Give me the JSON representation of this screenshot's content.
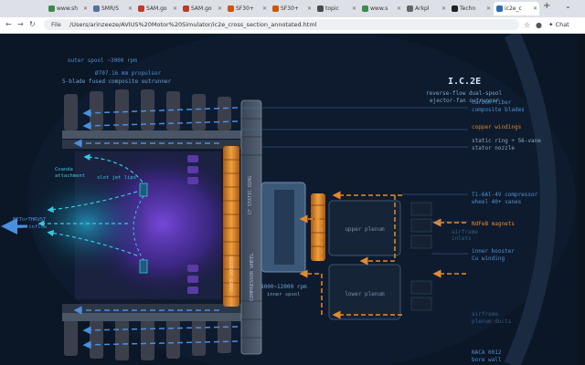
{
  "browser": {
    "tabs": [
      {
        "label": "www.sh",
        "color": "#3c8b4a"
      },
      {
        "label": "SMR/S",
        "color": "#5a6e9a"
      },
      {
        "label": "SAM.go",
        "color": "#c0392b"
      },
      {
        "label": "SAM.go",
        "color": "#c0392b"
      },
      {
        "label": "SF30+",
        "color": "#d35400"
      },
      {
        "label": "SF30+",
        "color": "#d35400"
      },
      {
        "label": "topic",
        "color": "#4a4a4a"
      },
      {
        "label": "www.s",
        "color": "#3c8b4a"
      },
      {
        "label": "Arkpl",
        "color": "#666666"
      },
      {
        "label": "Techn",
        "color": "#222222"
      },
      {
        "label": "ic2e_c",
        "color": "#2b6cb0"
      }
    ],
    "new_tab": "+",
    "url_prefix": "File",
    "url": "/Users/arinzeeze/AVIUS%20Motor%20Simulator/ic2e_cross_section_annotated.html",
    "chat_label": "Chat"
  },
  "diagram": {
    "title": "I.C.2E",
    "subtitle_1": "reverse-flow dual-spool",
    "subtitle_2": "ejector-fan outrunner",
    "outer_spool": "outer spool ~3000 rpm",
    "propulsor_1": "Ø707.16 mm propulsor",
    "propulsor_2": "5-blade fused composite outrunner",
    "coanda_1": "Coanda",
    "coanda_2": "attachment",
    "slot_jet": "slot jet lips",
    "exhaust_1": "NETorTHRUST",
    "exhaust_2": "air inflow",
    "compressor_vert": "COMPRESSOR WHEEL",
    "booster_vert": "INNER BOOSTER",
    "cf_vert": "CF STATIC RING",
    "inner_spool_1": "8000~12000 rpm",
    "inner_spool_2": "inner spool",
    "upper_plenum": "upper plenum",
    "lower_plenum": "lower plenum",
    "callouts": {
      "carbon_1": "carbon-fiber",
      "carbon_2": "composite blades",
      "copper": "copper windings",
      "static_1": "static ring + 56-vane",
      "static_2": "stator nozzle",
      "ti_1": "Ti-6Al-4V compressor",
      "ti_2": "wheel 40+ vanes",
      "ndfeb": "NdFeB magnets",
      "airframe_1": "airframe",
      "airframe_2": "inlets",
      "booster_1": "inner booster",
      "booster_2": "Cu winding",
      "plenum_1": "airframe",
      "plenum_2": "plenum ducts",
      "naca_1": "NACA 0012",
      "naca_2": "bore wall"
    },
    "colors": {
      "background": "#0b1626",
      "cyan": "#38c6e0",
      "blue_arrow": "#4a8fe0",
      "orange": "#e58a2c",
      "copper": "#d9862b",
      "violet": "#6b3bc9",
      "label_blue": "#4f8fd0"
    }
  }
}
